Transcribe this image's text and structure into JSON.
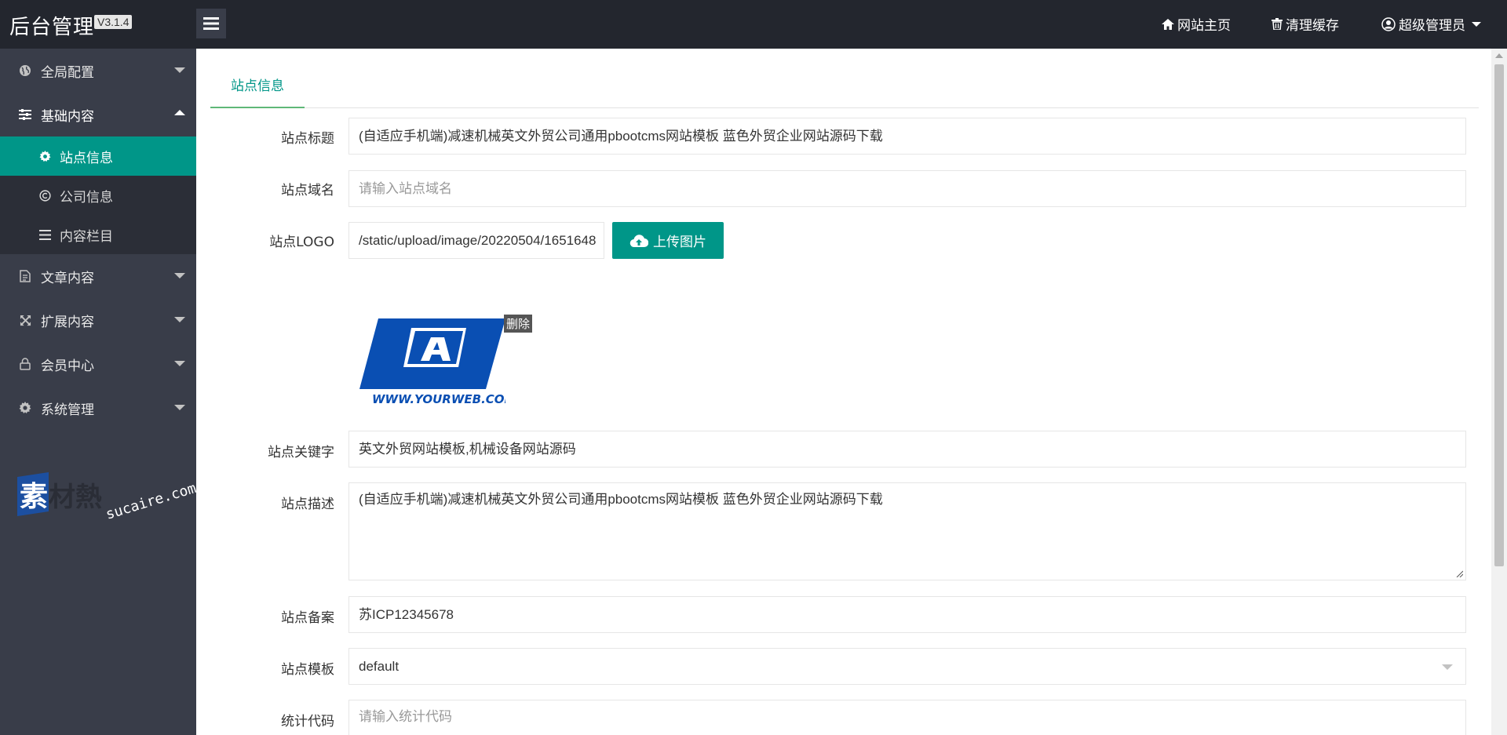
{
  "header": {
    "logo": "后台管理",
    "version": "V3.1.4",
    "home_label": "网站主页",
    "cache_label": "清理缓存",
    "user_label": "超级管理员"
  },
  "sidebar": {
    "items": [
      {
        "label": "全局配置",
        "icon": "globe-icon"
      },
      {
        "label": "基础内容",
        "icon": "sliders-icon"
      },
      {
        "label": "文章内容",
        "icon": "document-icon"
      },
      {
        "label": "扩展内容",
        "icon": "expand-icon"
      },
      {
        "label": "会员中心",
        "icon": "lock-icon"
      },
      {
        "label": "系统管理",
        "icon": "gear-icon"
      }
    ],
    "sub_items": [
      {
        "label": "站点信息",
        "icon": "gear-icon",
        "active": true
      },
      {
        "label": "公司信息",
        "icon": "copyright-icon",
        "active": false
      },
      {
        "label": "内容栏目",
        "icon": "list-icon",
        "active": false
      }
    ],
    "watermark": {
      "main": "素材熱",
      "url": "sucaire.com"
    }
  },
  "tabs": [
    "站点信息"
  ],
  "form": {
    "title": {
      "label": "站点标题",
      "value": "(自适应手机端)减速机械英文外贸公司通用pbootcms网站模板 蓝色外贸企业网站源码下载"
    },
    "domain": {
      "label": "站点域名",
      "placeholder": "请输入站点域名"
    },
    "logo": {
      "label": "站点LOGO",
      "value": "/static/upload/image/20220504/1651648",
      "upload_label": "上传图片",
      "delete_label": "删除",
      "preview_text": "WWW.YOURWEB.COM"
    },
    "keywords": {
      "label": "站点关键字",
      "value": "英文外贸网站模板,机械设备网站源码"
    },
    "description": {
      "label": "站点描述",
      "value": "(自适应手机端)减速机械英文外贸公司通用pbootcms网站模板 蓝色外贸企业网站源码下载"
    },
    "icp": {
      "label": "站点备案",
      "value": "苏ICP12345678"
    },
    "template": {
      "label": "站点模板",
      "value": "default"
    },
    "stats": {
      "label": "统计代码",
      "placeholder": "请输入统计代码"
    }
  },
  "colors": {
    "accent": "#009688",
    "header_bg": "#23262e",
    "sidebar_bg": "#393d49",
    "logo_blue": "#0a4fb3"
  }
}
